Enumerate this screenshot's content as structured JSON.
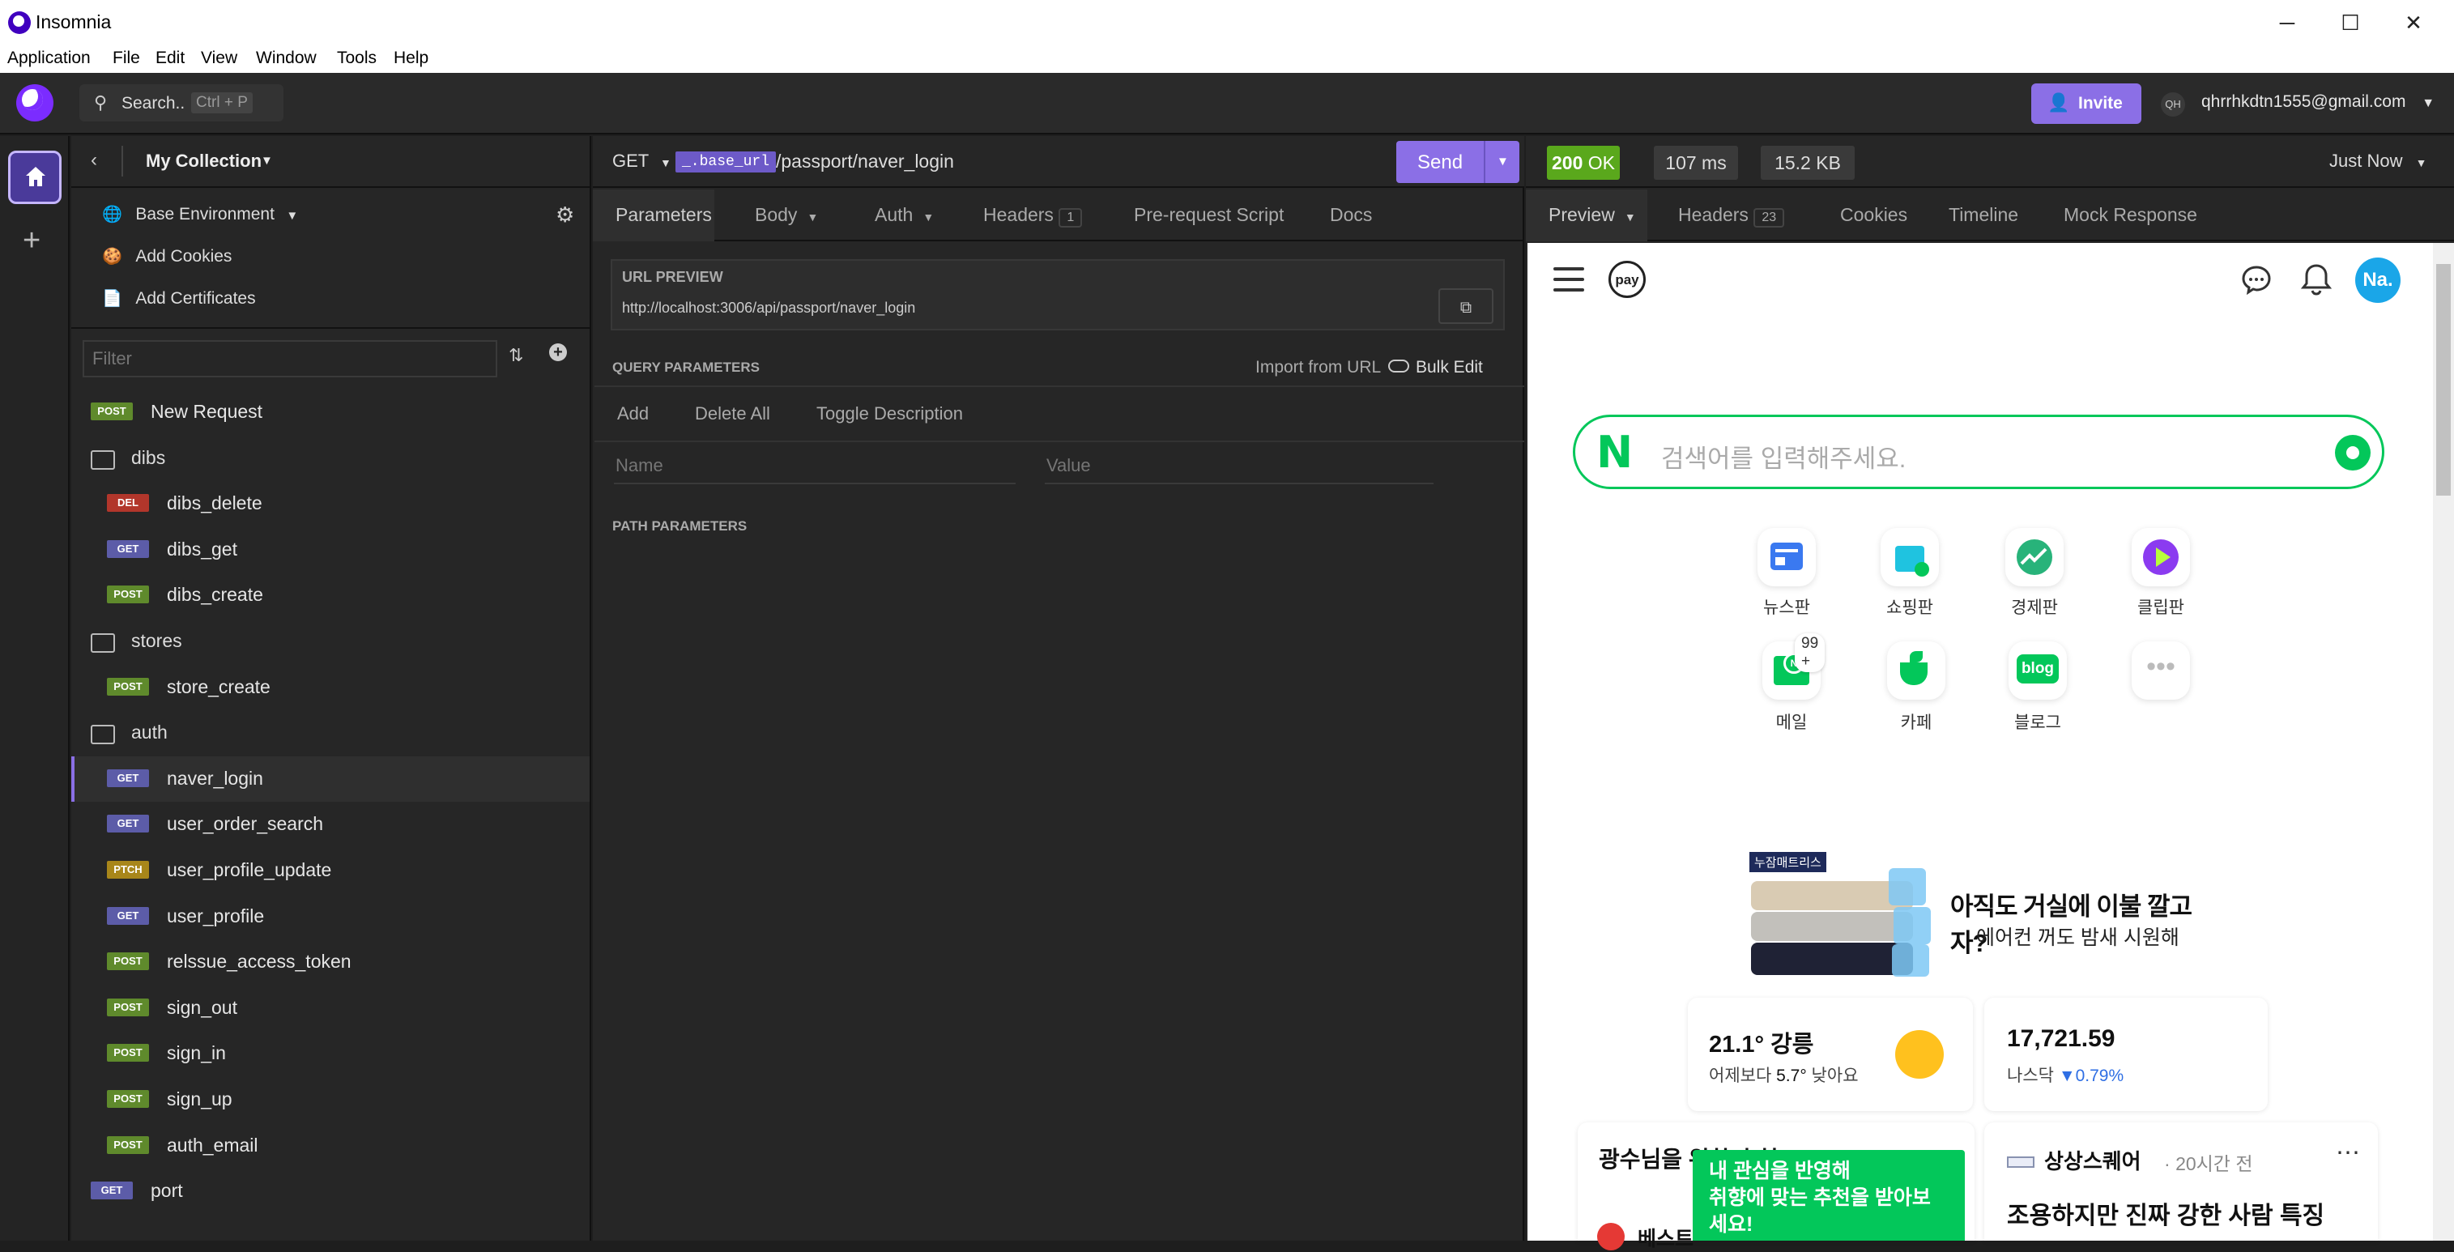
{
  "window": {
    "title": "Insomnia",
    "minimize": "─",
    "maximize": "☐",
    "close": "✕"
  },
  "menu": [
    "Application",
    "File",
    "Edit",
    "View",
    "Window",
    "Tools",
    "Help"
  ],
  "appbar": {
    "search_label": "Search..",
    "search_shortcut": "Ctrl + P",
    "invite_label": "Invite",
    "user_initials": "QH",
    "user_email": "qhrrhkdtn1555@gmail.com"
  },
  "sidebar": {
    "collection": "My Collection",
    "environment": "Base Environment",
    "add_cookies": "Add Cookies",
    "add_certificates": "Add Certificates",
    "filter_placeholder": "Filter",
    "items": [
      {
        "type": "request",
        "method": "POST",
        "label": "New Request",
        "level": 0
      },
      {
        "type": "folder",
        "label": "dibs",
        "level": 0
      },
      {
        "type": "request",
        "method": "DEL",
        "label": "dibs_delete",
        "level": 1
      },
      {
        "type": "request",
        "method": "GET",
        "label": "dibs_get",
        "level": 1
      },
      {
        "type": "request",
        "method": "POST",
        "label": "dibs_create",
        "level": 1
      },
      {
        "type": "folder",
        "label": "stores",
        "level": 0
      },
      {
        "type": "request",
        "method": "POST",
        "label": "store_create",
        "level": 1
      },
      {
        "type": "folder",
        "label": "auth",
        "level": 0
      },
      {
        "type": "request",
        "method": "GET",
        "label": "naver_login",
        "level": 1,
        "active": true
      },
      {
        "type": "request",
        "method": "GET",
        "label": "user_order_search",
        "level": 1
      },
      {
        "type": "request",
        "method": "PTCH",
        "label": "user_profile_update",
        "level": 1
      },
      {
        "type": "request",
        "method": "GET",
        "label": "user_profile",
        "level": 1
      },
      {
        "type": "request",
        "method": "POST",
        "label": "relssue_access_token",
        "level": 1
      },
      {
        "type": "request",
        "method": "POST",
        "label": "sign_out",
        "level": 1
      },
      {
        "type": "request",
        "method": "POST",
        "label": "sign_in",
        "level": 1
      },
      {
        "type": "request",
        "method": "POST",
        "label": "sign_up",
        "level": 1
      },
      {
        "type": "request",
        "method": "POST",
        "label": "auth_email",
        "level": 1
      },
      {
        "type": "request",
        "method": "GET",
        "label": "port",
        "level": 0
      }
    ]
  },
  "request": {
    "method": "GET",
    "base_url_tag": "_.base_url",
    "path": "/passport/naver_login",
    "send_label": "Send",
    "tabs": {
      "parameters": "Parameters",
      "body": "Body",
      "auth": "Auth",
      "headers": "Headers",
      "headers_count": "1",
      "pre_request": "Pre-request Script",
      "docs": "Docs"
    },
    "url_preview_label": "URL PREVIEW",
    "url_preview": "http://localhost:3006/api/passport/naver_login",
    "query_params_label": "QUERY PARAMETERS",
    "import_from_url": "Import from URL",
    "bulk_edit": "Bulk Edit",
    "add": "Add",
    "delete_all": "Delete All",
    "toggle_description": "Toggle Description",
    "name_placeholder": "Name",
    "value_placeholder": "Value",
    "path_params_label": "PATH PARAMETERS"
  },
  "response": {
    "status_code": "200",
    "status_text": "OK",
    "time": "107 ms",
    "size": "15.2 KB",
    "when": "Just Now",
    "tabs": {
      "preview": "Preview",
      "headers": "Headers",
      "headers_count": "23",
      "cookies": "Cookies",
      "timeline": "Timeline",
      "mock": "Mock Response"
    }
  },
  "preview_page": {
    "pay": "pay",
    "profile": "Na.",
    "search_placeholder": "검색어를 입력해주세요.",
    "shortcuts": [
      {
        "label": "뉴스판",
        "icon": "news-icon"
      },
      {
        "label": "쇼핑판",
        "icon": "shopping-icon"
      },
      {
        "label": "경제판",
        "icon": "finance-icon"
      },
      {
        "label": "클립판",
        "icon": "clip-icon"
      },
      {
        "label": "메일",
        "icon": "mail-icon",
        "badge": "99 +"
      },
      {
        "label": "카페",
        "icon": "cafe-icon"
      },
      {
        "label": "블로그",
        "icon": "blog-icon",
        "text": "blog"
      },
      {
        "label": "",
        "icon": "more-icon"
      }
    ],
    "ad": {
      "tag": "누잠매트리스",
      "headline": "아직도 거실에 이불 깔고 자?",
      "sub": "에어컨 꺼도 밤새 시원해"
    },
    "weather": {
      "temp": "21.1°",
      "place": "강릉",
      "detail_prefix": "어제보다 ",
      "detail_value": "5.7°",
      "detail_suffix": " 낮아요"
    },
    "stock": {
      "value": "17,721.59",
      "name": "나스닥",
      "change": "0.79%"
    },
    "feed_left_title": "광수님을 위한 추천",
    "tooltip_lines": [
      "내 관심을 반영해",
      "취향에 맞는 추천을 받아보",
      "세요!"
    ],
    "feed_left_snippet": "베스트",
    "feed_right_source": "상상스퀘어",
    "feed_right_time": "20시간 전",
    "feed_right_title": "조용하지만 진짜 강한 사람 특징"
  }
}
